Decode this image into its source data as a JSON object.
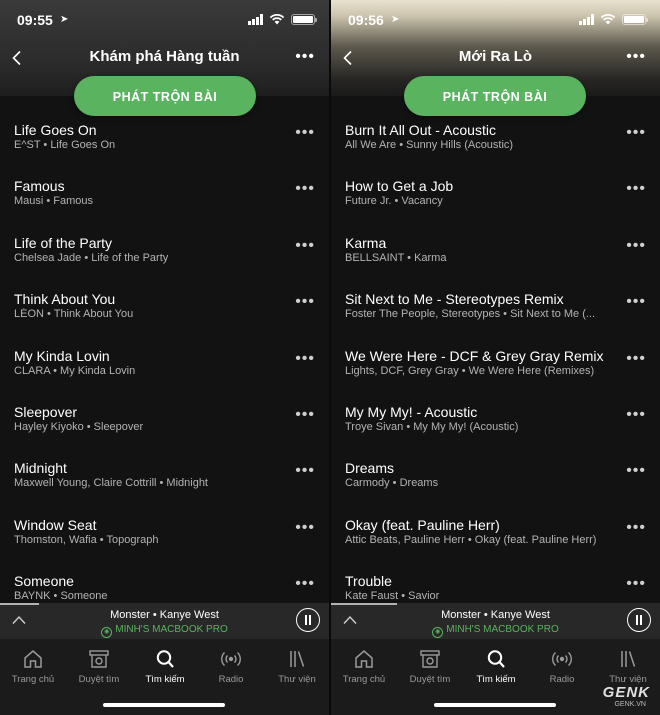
{
  "screens": [
    {
      "status": {
        "time": "09:55"
      },
      "title": "Khám phá Hàng tuần",
      "shuffle_label": "PHÁT TRỘN BÀI",
      "tracks": [
        {
          "title": "Life Goes On",
          "subtitle": "E^ST • Life Goes On"
        },
        {
          "title": "Famous",
          "subtitle": "Mausi • Famous"
        },
        {
          "title": "Life of the Party",
          "subtitle": "Chelsea Jade • Life of the Party"
        },
        {
          "title": "Think About You",
          "subtitle": "LÉON • Think About You"
        },
        {
          "title": "My Kinda Lovin",
          "subtitle": "CLARA • My Kinda Lovin"
        },
        {
          "title": "Sleepover",
          "subtitle": "Hayley Kiyoko • Sleepover"
        },
        {
          "title": "Midnight",
          "subtitle": "Maxwell Young, Claire Cottrill • Midnight"
        },
        {
          "title": "Window Seat",
          "subtitle": "Thomston, Wafia • Topograph"
        },
        {
          "title": "Someone",
          "subtitle": "BAYNK • Someone"
        }
      ],
      "now_playing": {
        "track": "Monster • Kanye West",
        "device": "MINH'S MACBOOK PRO",
        "progress": 0.12
      }
    },
    {
      "status": {
        "time": "09:56"
      },
      "title": "Mới Ra Lò",
      "shuffle_label": "PHÁT TRỘN BÀI",
      "tracks": [
        {
          "title": "Burn It All Out - Acoustic",
          "subtitle": "All We Are • Sunny Hills (Acoustic)"
        },
        {
          "title": "How to Get a Job",
          "subtitle": "Future Jr. • Vacancy"
        },
        {
          "title": "Karma",
          "subtitle": "BELLSAINT • Karma"
        },
        {
          "title": "Sit Next to Me - Stereotypes Remix",
          "subtitle": "Foster The People, Stereotypes • Sit Next to Me (..."
        },
        {
          "title": "We Were Here - DCF & Grey Gray Remix",
          "subtitle": "Lights, DCF, Grey Gray • We Were Here (Remixes)"
        },
        {
          "title": "My My My! - Acoustic",
          "subtitle": "Troye Sivan • My My My! (Acoustic)"
        },
        {
          "title": "Dreams",
          "subtitle": "Carmody • Dreams"
        },
        {
          "title": "Okay (feat. Pauline Herr)",
          "subtitle": "Attic Beats, Pauline Herr • Okay (feat. Pauline Herr)"
        },
        {
          "title": "Trouble",
          "subtitle": "Kate Faust • Savior"
        }
      ],
      "now_playing": {
        "track": "Monster • Kanye West",
        "device": "MINH'S MACBOOK PRO",
        "progress": 0.2
      }
    }
  ],
  "tabs": [
    {
      "label": "Trang chủ",
      "icon": "home-icon"
    },
    {
      "label": "Duyệt tìm",
      "icon": "browse-icon"
    },
    {
      "label": "Tìm kiếm",
      "icon": "search-icon"
    },
    {
      "label": "Radio",
      "icon": "radio-icon"
    },
    {
      "label": "Thư viện",
      "icon": "library-icon"
    }
  ],
  "active_tab": 2,
  "colors": {
    "accent": "#5ab35f",
    "background": "#121212"
  },
  "watermark": {
    "brand": "GENK",
    "site": "GENK.VN"
  }
}
